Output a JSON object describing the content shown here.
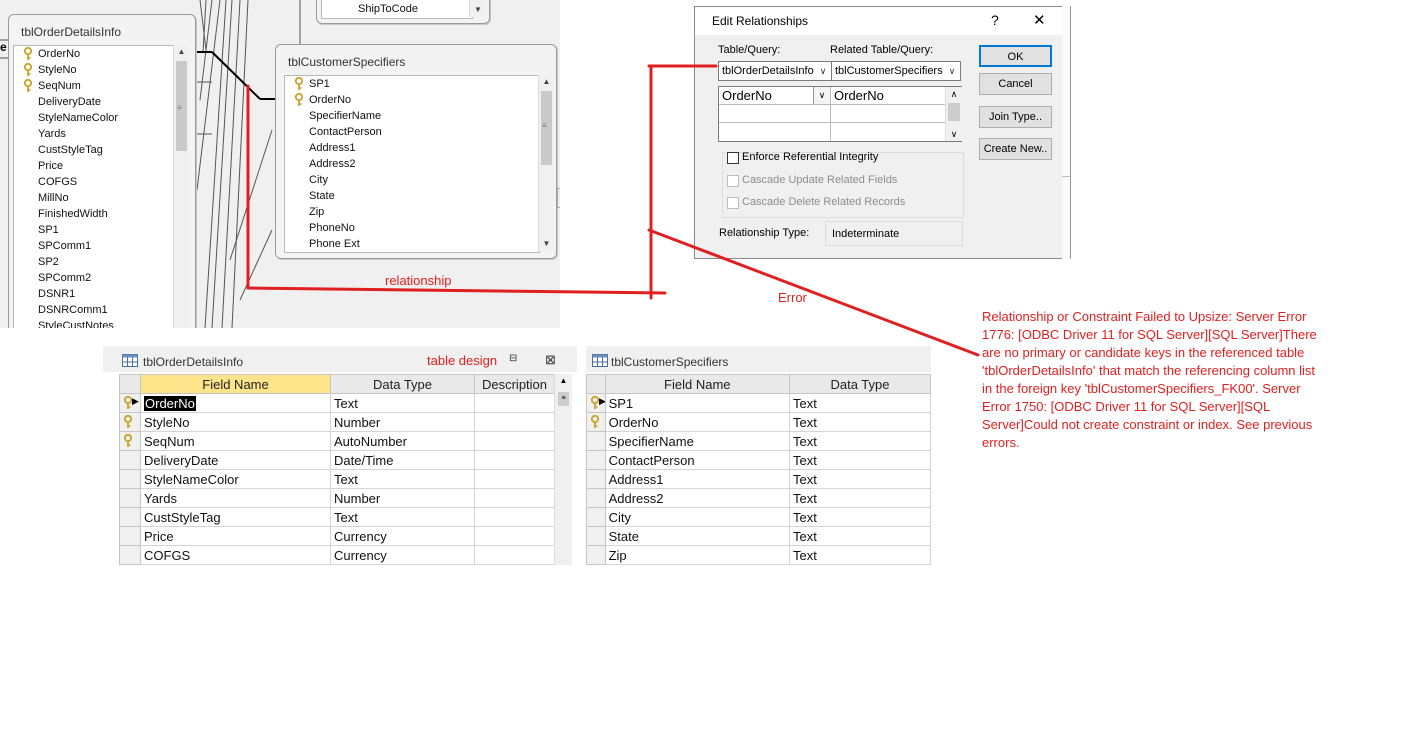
{
  "relationships_window": {
    "left_table": {
      "title": "tblOrderDetailsInfo",
      "fields": [
        {
          "name": "OrderNo",
          "key": true
        },
        {
          "name": "StyleNo",
          "key": true
        },
        {
          "name": "SeqNum",
          "key": true
        },
        {
          "name": "DeliveryDate",
          "key": false
        },
        {
          "name": "StyleNameColor",
          "key": false
        },
        {
          "name": "Yards",
          "key": false
        },
        {
          "name": "CustStyleTag",
          "key": false
        },
        {
          "name": "Price",
          "key": false
        },
        {
          "name": "COFGS",
          "key": false
        },
        {
          "name": "MillNo",
          "key": false
        },
        {
          "name": "FinishedWidth",
          "key": false
        },
        {
          "name": "SP1",
          "key": false
        },
        {
          "name": "SPComm1",
          "key": false
        },
        {
          "name": "SP2",
          "key": false
        },
        {
          "name": "SPComm2",
          "key": false
        },
        {
          "name": "DSNR1",
          "key": false
        },
        {
          "name": "DSNRComm1",
          "key": false
        },
        {
          "name": "StyleCustNotes",
          "key": false
        }
      ]
    },
    "right_table": {
      "title": "tblCustomerSpecifiers",
      "fields": [
        {
          "name": "SP1",
          "key": true
        },
        {
          "name": "OrderNo",
          "key": true
        },
        {
          "name": "SpecifierName",
          "key": false
        },
        {
          "name": "ContactPerson",
          "key": false
        },
        {
          "name": "Address1",
          "key": false
        },
        {
          "name": "Address2",
          "key": false
        },
        {
          "name": "City",
          "key": false
        },
        {
          "name": "State",
          "key": false
        },
        {
          "name": "Zip",
          "key": false
        },
        {
          "name": "PhoneNo",
          "key": false
        },
        {
          "name": "Phone Ext",
          "key": false
        }
      ]
    },
    "top_partial_table": {
      "fields": [
        "ShipToCode"
      ]
    }
  },
  "dialog": {
    "title": "Edit Relationships",
    "help_label": "?",
    "close_label": "✕",
    "table_query_label": "Table/Query:",
    "related_table_query_label": "Related Table/Query:",
    "table_query_value": "tblOrderDetailsInfo",
    "related_table_query_value": "tblCustomerSpecifiers",
    "join_rows": [
      {
        "left": "OrderNo",
        "right": "OrderNo"
      },
      {
        "left": "",
        "right": ""
      },
      {
        "left": "",
        "right": ""
      }
    ],
    "enforce_label": "Enforce Referential Integrity",
    "cascade_update_label": "Cascade Update Related Fields",
    "cascade_delete_label": "Cascade Delete Related Records",
    "relationship_type_label": "Relationship Type:",
    "relationship_type_value": "Indeterminate",
    "ok_label": "OK",
    "cancel_label": "Cancel",
    "join_type_label": "Join Type..",
    "create_new_label": "Create New.."
  },
  "design_left": {
    "tab_title": "tblOrderDetailsInfo",
    "columns": [
      "Field Name",
      "Data Type",
      "Description"
    ],
    "rows": [
      {
        "field": "OrderNo",
        "type": "Text",
        "key": true
      },
      {
        "field": "StyleNo",
        "type": "Number",
        "key": true
      },
      {
        "field": "SeqNum",
        "type": "AutoNumber",
        "key": true
      },
      {
        "field": "DeliveryDate",
        "type": "Date/Time",
        "key": false
      },
      {
        "field": "StyleNameColor",
        "type": "Text",
        "key": false
      },
      {
        "field": "Yards",
        "type": "Number",
        "key": false
      },
      {
        "field": "CustStyleTag",
        "type": "Text",
        "key": false
      },
      {
        "field": "Price",
        "type": "Currency",
        "key": false
      },
      {
        "field": "COFGS",
        "type": "Currency",
        "key": false
      }
    ]
  },
  "design_right": {
    "tab_title": "tblCustomerSpecifiers",
    "columns": [
      "Field Name",
      "Data Type"
    ],
    "rows": [
      {
        "field": "SP1",
        "type": "Text",
        "key": true
      },
      {
        "field": "OrderNo",
        "type": "Text",
        "key": true
      },
      {
        "field": "SpecifierName",
        "type": "Text",
        "key": false
      },
      {
        "field": "ContactPerson",
        "type": "Text",
        "key": false
      },
      {
        "field": "Address1",
        "type": "Text",
        "key": false
      },
      {
        "field": "Address2",
        "type": "Text",
        "key": false
      },
      {
        "field": "City",
        "type": "Text",
        "key": false
      },
      {
        "field": "State",
        "type": "Text",
        "key": false
      },
      {
        "field": "Zip",
        "type": "Text",
        "key": false
      }
    ]
  },
  "annotations": {
    "relationship": "relationship",
    "table_design": "table design",
    "error": "Error",
    "error_message": "Relationship or Constraint Failed to Upsize: Server Error 1776: [ODBC Driver 11 for SQL Server][SQL Server]There are no primary or candidate keys in the referenced table 'tblOrderDetailsInfo' that match the referencing column list in the foreign key 'tblCustomerSpecifiers_FK00'. Server Error 1750: [ODBC Driver 11 for SQL Server][SQL Server]Could not create constraint or index. See previous errors."
  },
  "colors": {
    "annotation_red": "#e02020",
    "key_gold": "#c9a227"
  }
}
